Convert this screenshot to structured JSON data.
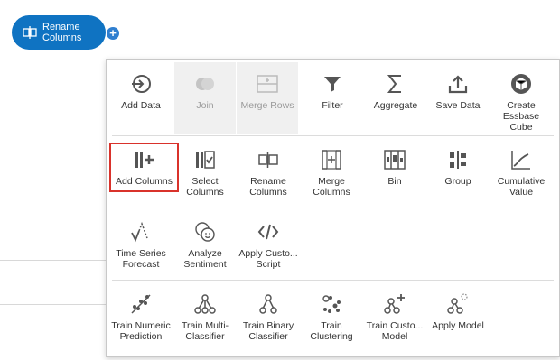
{
  "flow": {
    "node_label": "Rename Columns",
    "add_button": "+"
  },
  "menu": {
    "row1": [
      {
        "label": "Add Data",
        "icon": "add-data-icon"
      },
      {
        "label": "Join",
        "icon": "join-icon",
        "disabled": true
      },
      {
        "label": "Merge Rows",
        "icon": "merge-rows-icon",
        "disabled": true
      },
      {
        "label": "Filter",
        "icon": "filter-icon"
      },
      {
        "label": "Aggregate",
        "icon": "sigma-icon"
      },
      {
        "label": "Save Data",
        "icon": "save-data-icon"
      },
      {
        "label": "Create Essbase Cube",
        "icon": "cube-icon"
      }
    ],
    "row2": [
      {
        "label": "Add Columns",
        "icon": "add-columns-icon",
        "highlighted": true
      },
      {
        "label": "Select Columns",
        "icon": "select-columns-icon"
      },
      {
        "label": "Rename Columns",
        "icon": "rename-columns-icon"
      },
      {
        "label": "Merge Columns",
        "icon": "merge-columns-icon"
      },
      {
        "label": "Bin",
        "icon": "bin-icon"
      },
      {
        "label": "Group",
        "icon": "group-icon"
      },
      {
        "label": "Cumulative Value",
        "icon": "cumulative-value-icon"
      }
    ],
    "row3": [
      {
        "label": "Time Series Forecast",
        "icon": "time-series-icon"
      },
      {
        "label": "Analyze Sentiment",
        "icon": "sentiment-icon"
      },
      {
        "label": "Apply Custo... Script",
        "icon": "script-icon"
      }
    ],
    "row4": [
      {
        "label": "Train Numeric Prediction",
        "icon": "train-numeric-icon"
      },
      {
        "label": "Train Multi-Classifier",
        "icon": "train-multi-classifier-icon"
      },
      {
        "label": "Train Binary Classifier",
        "icon": "train-binary-classifier-icon"
      },
      {
        "label": "Train Clustering",
        "icon": "train-clustering-icon"
      },
      {
        "label": "Train Custo... Model",
        "icon": "train-custom-model-icon"
      },
      {
        "label": "Apply Model",
        "icon": "apply-model-icon"
      }
    ]
  }
}
